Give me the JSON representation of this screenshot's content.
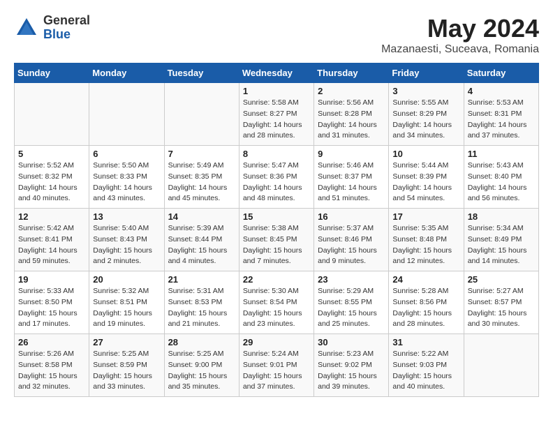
{
  "logo": {
    "general": "General",
    "blue": "Blue"
  },
  "title": "May 2024",
  "location": "Mazanaesti, Suceava, Romania",
  "days_of_week": [
    "Sunday",
    "Monday",
    "Tuesday",
    "Wednesday",
    "Thursday",
    "Friday",
    "Saturday"
  ],
  "weeks": [
    [
      {
        "day": "",
        "info": ""
      },
      {
        "day": "",
        "info": ""
      },
      {
        "day": "",
        "info": ""
      },
      {
        "day": "1",
        "info": "Sunrise: 5:58 AM\nSunset: 8:27 PM\nDaylight: 14 hours\nand 28 minutes."
      },
      {
        "day": "2",
        "info": "Sunrise: 5:56 AM\nSunset: 8:28 PM\nDaylight: 14 hours\nand 31 minutes."
      },
      {
        "day": "3",
        "info": "Sunrise: 5:55 AM\nSunset: 8:29 PM\nDaylight: 14 hours\nand 34 minutes."
      },
      {
        "day": "4",
        "info": "Sunrise: 5:53 AM\nSunset: 8:31 PM\nDaylight: 14 hours\nand 37 minutes."
      }
    ],
    [
      {
        "day": "5",
        "info": "Sunrise: 5:52 AM\nSunset: 8:32 PM\nDaylight: 14 hours\nand 40 minutes."
      },
      {
        "day": "6",
        "info": "Sunrise: 5:50 AM\nSunset: 8:33 PM\nDaylight: 14 hours\nand 43 minutes."
      },
      {
        "day": "7",
        "info": "Sunrise: 5:49 AM\nSunset: 8:35 PM\nDaylight: 14 hours\nand 45 minutes."
      },
      {
        "day": "8",
        "info": "Sunrise: 5:47 AM\nSunset: 8:36 PM\nDaylight: 14 hours\nand 48 minutes."
      },
      {
        "day": "9",
        "info": "Sunrise: 5:46 AM\nSunset: 8:37 PM\nDaylight: 14 hours\nand 51 minutes."
      },
      {
        "day": "10",
        "info": "Sunrise: 5:44 AM\nSunset: 8:39 PM\nDaylight: 14 hours\nand 54 minutes."
      },
      {
        "day": "11",
        "info": "Sunrise: 5:43 AM\nSunset: 8:40 PM\nDaylight: 14 hours\nand 56 minutes."
      }
    ],
    [
      {
        "day": "12",
        "info": "Sunrise: 5:42 AM\nSunset: 8:41 PM\nDaylight: 14 hours\nand 59 minutes."
      },
      {
        "day": "13",
        "info": "Sunrise: 5:40 AM\nSunset: 8:43 PM\nDaylight: 15 hours\nand 2 minutes."
      },
      {
        "day": "14",
        "info": "Sunrise: 5:39 AM\nSunset: 8:44 PM\nDaylight: 15 hours\nand 4 minutes."
      },
      {
        "day": "15",
        "info": "Sunrise: 5:38 AM\nSunset: 8:45 PM\nDaylight: 15 hours\nand 7 minutes."
      },
      {
        "day": "16",
        "info": "Sunrise: 5:37 AM\nSunset: 8:46 PM\nDaylight: 15 hours\nand 9 minutes."
      },
      {
        "day": "17",
        "info": "Sunrise: 5:35 AM\nSunset: 8:48 PM\nDaylight: 15 hours\nand 12 minutes."
      },
      {
        "day": "18",
        "info": "Sunrise: 5:34 AM\nSunset: 8:49 PM\nDaylight: 15 hours\nand 14 minutes."
      }
    ],
    [
      {
        "day": "19",
        "info": "Sunrise: 5:33 AM\nSunset: 8:50 PM\nDaylight: 15 hours\nand 17 minutes."
      },
      {
        "day": "20",
        "info": "Sunrise: 5:32 AM\nSunset: 8:51 PM\nDaylight: 15 hours\nand 19 minutes."
      },
      {
        "day": "21",
        "info": "Sunrise: 5:31 AM\nSunset: 8:53 PM\nDaylight: 15 hours\nand 21 minutes."
      },
      {
        "day": "22",
        "info": "Sunrise: 5:30 AM\nSunset: 8:54 PM\nDaylight: 15 hours\nand 23 minutes."
      },
      {
        "day": "23",
        "info": "Sunrise: 5:29 AM\nSunset: 8:55 PM\nDaylight: 15 hours\nand 25 minutes."
      },
      {
        "day": "24",
        "info": "Sunrise: 5:28 AM\nSunset: 8:56 PM\nDaylight: 15 hours\nand 28 minutes."
      },
      {
        "day": "25",
        "info": "Sunrise: 5:27 AM\nSunset: 8:57 PM\nDaylight: 15 hours\nand 30 minutes."
      }
    ],
    [
      {
        "day": "26",
        "info": "Sunrise: 5:26 AM\nSunset: 8:58 PM\nDaylight: 15 hours\nand 32 minutes."
      },
      {
        "day": "27",
        "info": "Sunrise: 5:25 AM\nSunset: 8:59 PM\nDaylight: 15 hours\nand 33 minutes."
      },
      {
        "day": "28",
        "info": "Sunrise: 5:25 AM\nSunset: 9:00 PM\nDaylight: 15 hours\nand 35 minutes."
      },
      {
        "day": "29",
        "info": "Sunrise: 5:24 AM\nSunset: 9:01 PM\nDaylight: 15 hours\nand 37 minutes."
      },
      {
        "day": "30",
        "info": "Sunrise: 5:23 AM\nSunset: 9:02 PM\nDaylight: 15 hours\nand 39 minutes."
      },
      {
        "day": "31",
        "info": "Sunrise: 5:22 AM\nSunset: 9:03 PM\nDaylight: 15 hours\nand 40 minutes."
      },
      {
        "day": "",
        "info": ""
      }
    ]
  ]
}
